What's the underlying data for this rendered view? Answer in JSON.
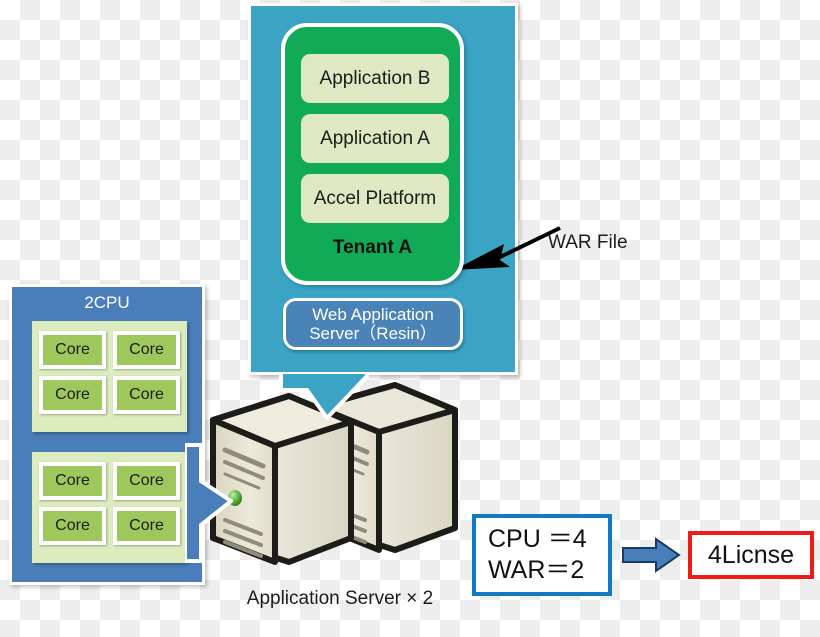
{
  "diagram": {
    "title": "Accel Platform license calculation diagram",
    "colors": {
      "teal_panel": "#3ba4c5",
      "tenant_green": "#11aa56",
      "app_box": "#dee8c2",
      "cpu_panel_blue": "#4a7ebb",
      "cpu_group": "#dcecbf",
      "core_green": "#9ec75c",
      "formula_border": "#1479c4",
      "license_border": "#ef1b19",
      "server_body": "#e3e1cd"
    }
  },
  "web_app_panel": {
    "tenant": {
      "label": "Tenant A",
      "applications": [
        {
          "label": "Application B"
        },
        {
          "label": "Application A"
        },
        {
          "label": "Accel Platform"
        }
      ]
    },
    "server_label_line1": "Web Application",
    "server_label_line2": "Server（Resin）"
  },
  "war_annotation": {
    "label": "WAR File",
    "arrow_icon": "arrow-left-icon"
  },
  "cpu_panel": {
    "title": "2CPU",
    "groups": [
      {
        "cores": [
          "Core",
          "Core",
          "Core",
          "Core"
        ]
      },
      {
        "cores": [
          "Core",
          "Core",
          "Core",
          "Core"
        ]
      }
    ]
  },
  "servers": {
    "caption": "Application Server × 2",
    "count": 2,
    "icon": "server-tower-icon"
  },
  "license": {
    "formula_line1": "CPU ＝4",
    "formula_line2": "WAR＝2",
    "arrow_icon": "arrow-right-icon",
    "result": "4Licnse"
  }
}
